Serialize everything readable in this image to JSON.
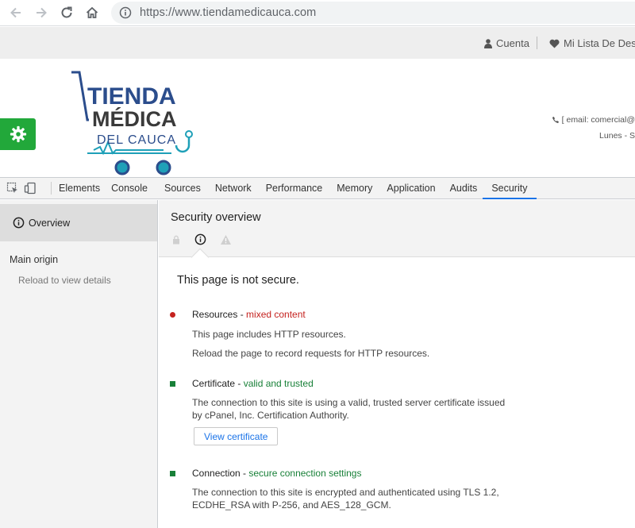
{
  "browser": {
    "url": "https://www.tiendamedicauca.com"
  },
  "site": {
    "topbar": {
      "account_label": "Cuenta",
      "wishlist_label": "Mi Lista De Deseos"
    },
    "logo": {
      "line1": "TIENDA",
      "line2": "MÉDICA",
      "line3": "DEL CAUCA"
    },
    "contact": {
      "email_line": "[ email:  comercial@",
      "hours_line": "Lunes - S"
    },
    "colors": {
      "gear_bg": "#22a83a",
      "logo_blue": "#2b4d8c",
      "logo_teal": "#1fa0b8"
    }
  },
  "devtools": {
    "tabs": [
      "Elements",
      "Console",
      "Sources",
      "Network",
      "Performance",
      "Memory",
      "Application",
      "Audits",
      "Security"
    ],
    "active_tab": "Security",
    "sidebar": {
      "overview_label": "Overview",
      "main_origin_label": "Main origin",
      "reload_hint": "Reload to view details"
    },
    "overview": {
      "title": "Security overview",
      "summary": "This page is not secure.",
      "resources": {
        "title": "Resources - ",
        "status": "mixed content",
        "line1": "This page includes HTTP resources.",
        "line2": "Reload the page to record requests for HTTP resources."
      },
      "certificate": {
        "title": "Certificate - ",
        "status": "valid and trusted",
        "desc": "The connection to this site is using a valid, trusted server certificate issued by cPanel, Inc. Certification Authority.",
        "button": "View certificate"
      },
      "connection": {
        "title": "Connection - ",
        "status": "secure connection settings",
        "desc": "The connection to this site is encrypted and authenticated using TLS 1.2, ECDHE_RSA with P-256, and AES_128_GCM."
      }
    }
  }
}
